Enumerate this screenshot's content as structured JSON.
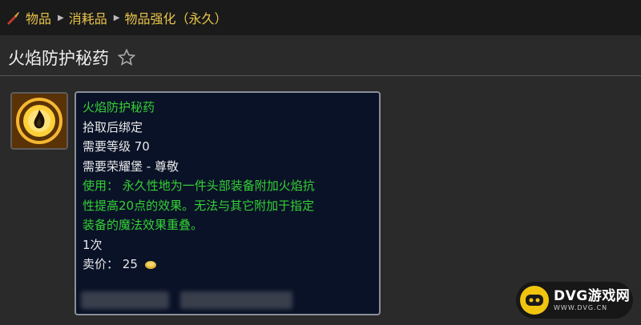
{
  "breadcrumb": {
    "items": [
      "物品",
      "消耗品",
      "物品强化（永久）"
    ]
  },
  "page": {
    "title": "火焰防护秘药"
  },
  "item_icon": "flame-potion-icon",
  "tooltip": {
    "name": "火焰防护秘药",
    "bind": "拾取后绑定",
    "level_req": "需要等级 70",
    "rep_req": "需要荣耀堡 - 尊敬",
    "use_lines": [
      "使用： 永久性地为一件头部装备附加火焰抗",
      "性提高20点的效果。无法与其它附加于指定",
      "装备的魔法效果重叠。"
    ],
    "charges": "1次",
    "sell_label": "卖价：",
    "sell_value": "25"
  },
  "watermark": {
    "text": "DVG游戏网",
    "url": "WWW.DVG.CN"
  },
  "colors": {
    "breadcrumb": "#e9c44a",
    "item_name": "#34d134",
    "tooltip_bg": "#0a1228"
  }
}
